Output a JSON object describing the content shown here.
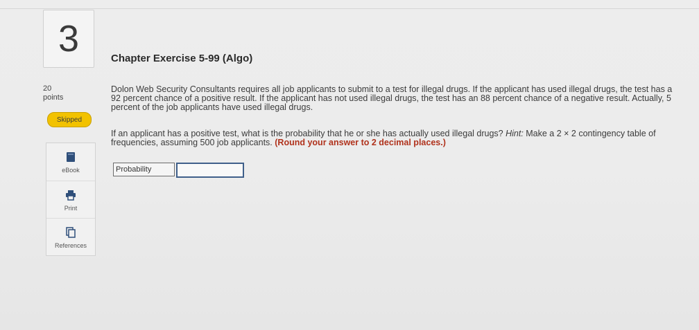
{
  "question": {
    "number": "3",
    "points_value": "20",
    "points_label": "points",
    "status": "Skipped",
    "title": "Chapter Exercise 5-99 (Algo)",
    "paragraph1": "Dolon Web Security Consultants requires all job applicants to submit to a test for illegal drugs. If the applicant has used illegal drugs, the test has a 92 percent chance of a positive result. If the applicant has not used illegal drugs, the test has an 88 percent chance of a negative result. Actually, 5 percent of the job applicants have used illegal drugs.",
    "paragraph2_main": "If an applicant has a positive test, what is the probability that he or she has actually used illegal drugs? ",
    "paragraph2_hint_label": "Hint:",
    "paragraph2_hint": " Make a 2 × 2 contingency table of frequencies, assuming 500 job applicants. ",
    "paragraph2_instruction": "(Round your answer to 2 decimal places.)",
    "answer_label": "Probability",
    "answer_value": ""
  },
  "tools": [
    {
      "label": "eBook",
      "icon": "book-icon"
    },
    {
      "label": "Print",
      "icon": "printer-icon"
    },
    {
      "label": "References",
      "icon": "references-icon"
    }
  ]
}
